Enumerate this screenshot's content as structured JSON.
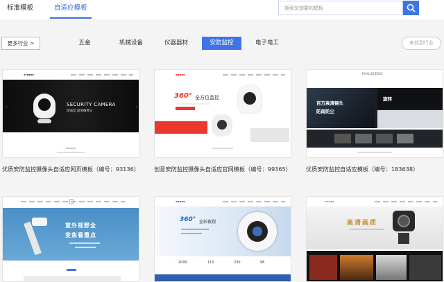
{
  "tabs": {
    "standard": "标准模板",
    "responsive": "自适应模板"
  },
  "search": {
    "placeholder": "搜索您想要的模板"
  },
  "filter": {
    "more": "更多行业 >",
    "categories": [
      "五金",
      "机械设备",
      "仪器器材",
      "安防监控",
      "电子电工"
    ],
    "active": "安防监控",
    "not_found": "未找到行业"
  },
  "cards": [
    {
      "title": "优质安防监控摄像头自适应网页模板（编号：93136）",
      "banner_small": "SECURITY CAMERA",
      "banner_sub": "加强型 超值摄像头"
    },
    {
      "title": "创意安防监控摄像头自适应官网模板（编号：99365）",
      "banner_head": "360°",
      "banner_text": "全方位监控"
    },
    {
      "title": "优质安防监控自适应模板（编号：183638）",
      "banner_left_1": "百万高清镜头",
      "banner_left_2": "防南防尘",
      "banner_right_1": "旋转",
      "logo": "PHILSEEDS"
    },
    {
      "title": "",
      "banner_1": "室外视野全",
      "banner_2": "变焦看重点"
    },
    {
      "title": "",
      "banner_head": "360°",
      "banner_text": "全彩夜视",
      "stats": [
        "2000",
        "110",
        "230",
        "98"
      ]
    },
    {
      "title": "",
      "banner_text": "高清画质"
    }
  ],
  "colors": {
    "accent": "#3e74e6",
    "red": "#e8382f"
  }
}
